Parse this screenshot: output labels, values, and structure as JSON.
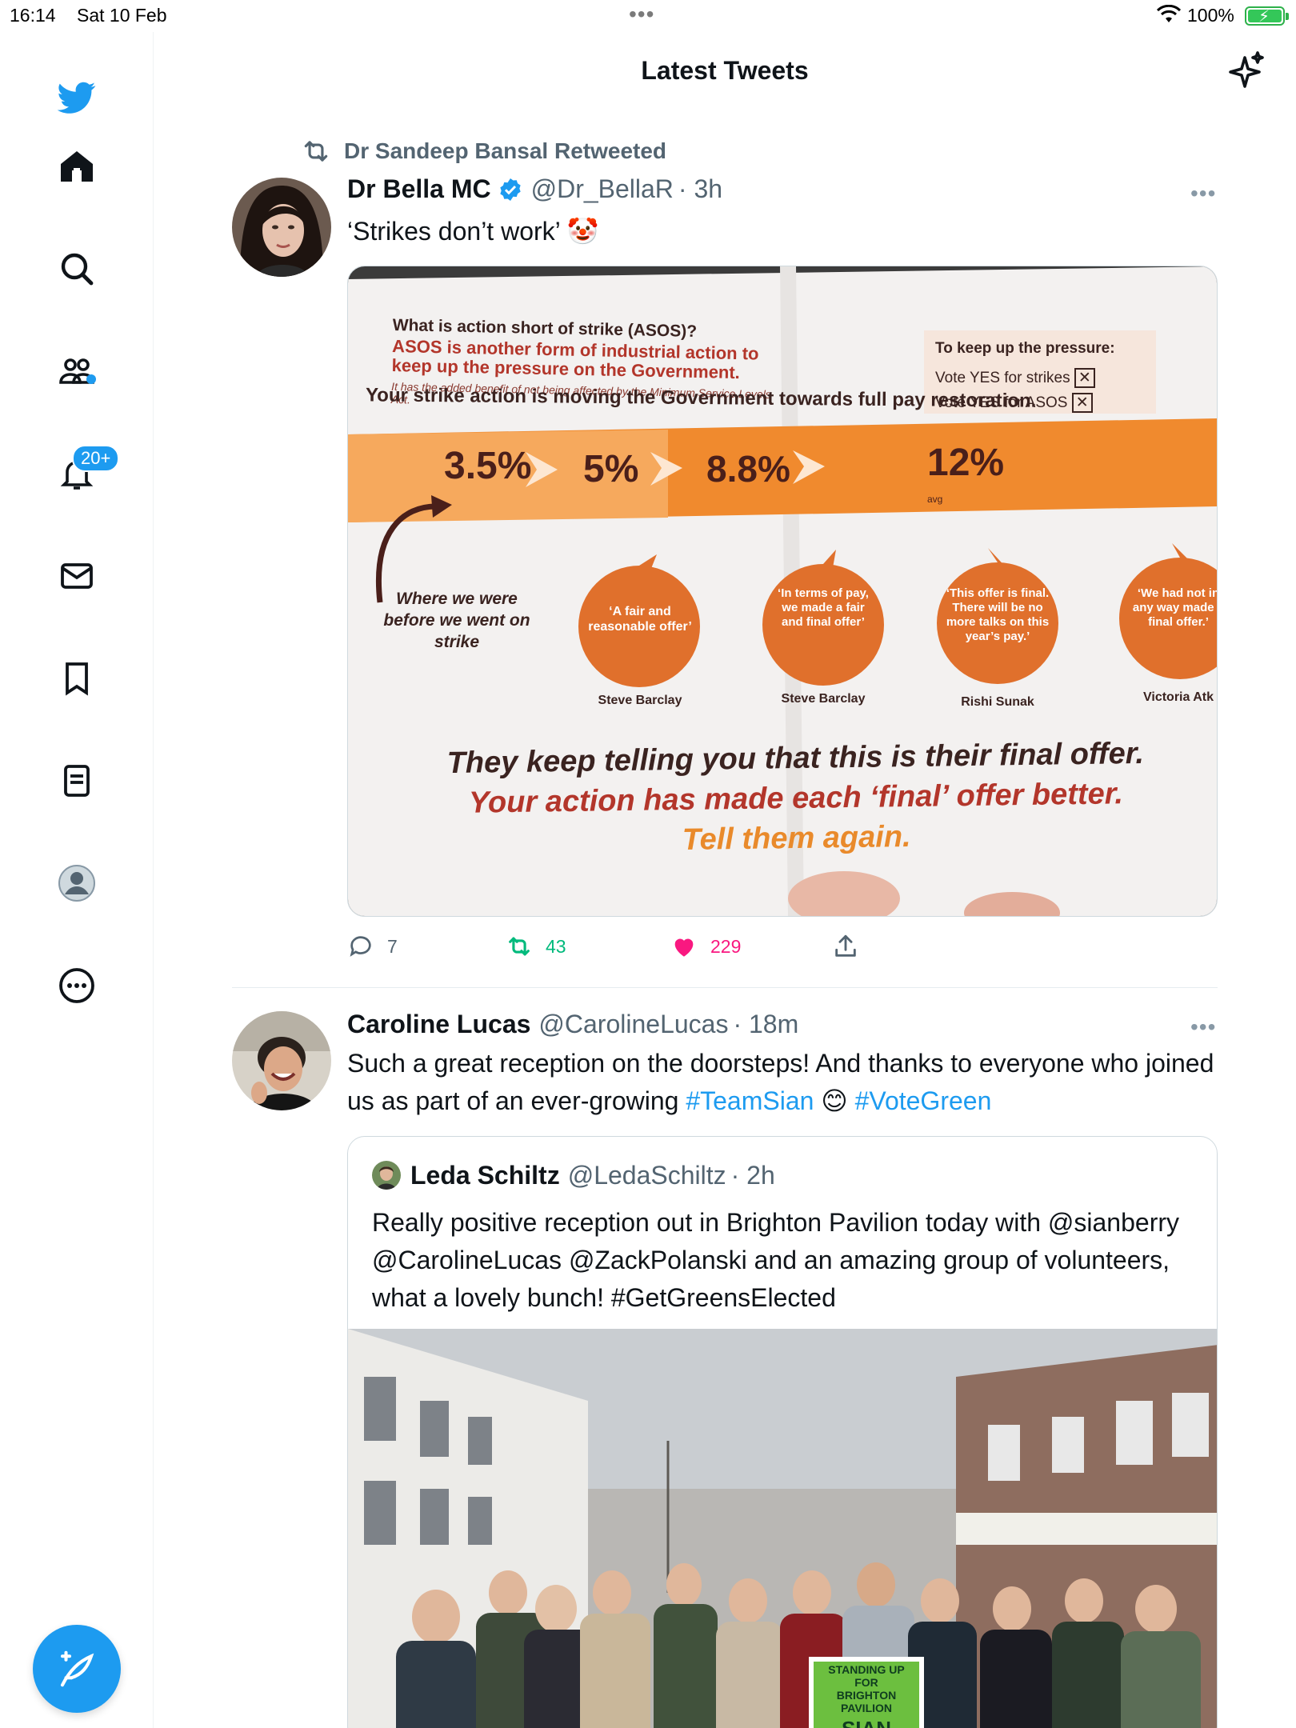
{
  "status_bar": {
    "time": "16:14",
    "date": "Sat 10 Feb",
    "battery": "100%",
    "battery_level": 1.0
  },
  "header": {
    "title": "Latest Tweets"
  },
  "sidebar": {
    "notifications_badge": "20+"
  },
  "tweets": [
    {
      "retweeted_by": "Dr Sandeep Bansal Retweeted",
      "name": "Dr Bella MC",
      "handle": "@Dr_BellaR",
      "time": "· 3h",
      "text": "‘Strikes don’t work’  🤡",
      "replies": "7",
      "retweets": "43",
      "likes": "229",
      "media": {
        "heading1": "What is action short of strike (ASOS)?",
        "heading2": "ASOS is another form of industrial action to keep up the pressure on the Government.",
        "small": "It has the added benefit of not being affected by the Minimum Service Levels Act.",
        "box_title": "To keep up the pressure:",
        "box_line1": "Vote YES for strikes",
        "box_line2": "Vote YES for ASOS",
        "strapline": "Your strike action is moving the Government towards full pay restoration.",
        "steps": [
          "3.5%",
          "5%",
          "8.8%",
          "12%"
        ],
        "avg_label": "avg",
        "before_text": "Where we were before we went on strike",
        "quotes": [
          {
            "text": "‘A fair and reasonable offer’",
            "by": "Steve Barclay"
          },
          {
            "text": "‘In terms of pay, we made a fair and final offer’",
            "by": "Steve Barclay"
          },
          {
            "text": "‘This offer is final. There will be no more talks on this year’s pay.’",
            "by": "Rishi Sunak"
          },
          {
            "text": "‘We had not in any way made a final offer.’",
            "by": "Victoria Atk"
          }
        ],
        "footer1": "They keep telling you that this is their final offer.",
        "footer2": "Your action has made each ‘final’ offer better.",
        "footer3": "Tell them again."
      }
    },
    {
      "name": "Caroline Lucas",
      "handle": "@CarolineLucas",
      "time": "· 18m",
      "text_part1": "Such a great reception on the doorsteps!  And thanks to everyone who joined us as part of an ever-growing ",
      "hashtag1": "#TeamSian",
      "emoji": " 😊 ",
      "hashtag2": "#VoteGreen",
      "quote": {
        "name": "Leda Schiltz",
        "handle": "@LedaSchiltz",
        "time": "· 2h",
        "text": "Really positive reception out in Brighton Pavilion today with @sianberry @CarolineLucas @ZackPolanski  and an amazing group of volunteers, what a lovely bunch! #GetGreensElected",
        "sign_line1": "STANDING UP FOR",
        "sign_line2": "BRIGHTON PAVILION",
        "sign_name": "SIAN BERRY"
      }
    }
  ]
}
